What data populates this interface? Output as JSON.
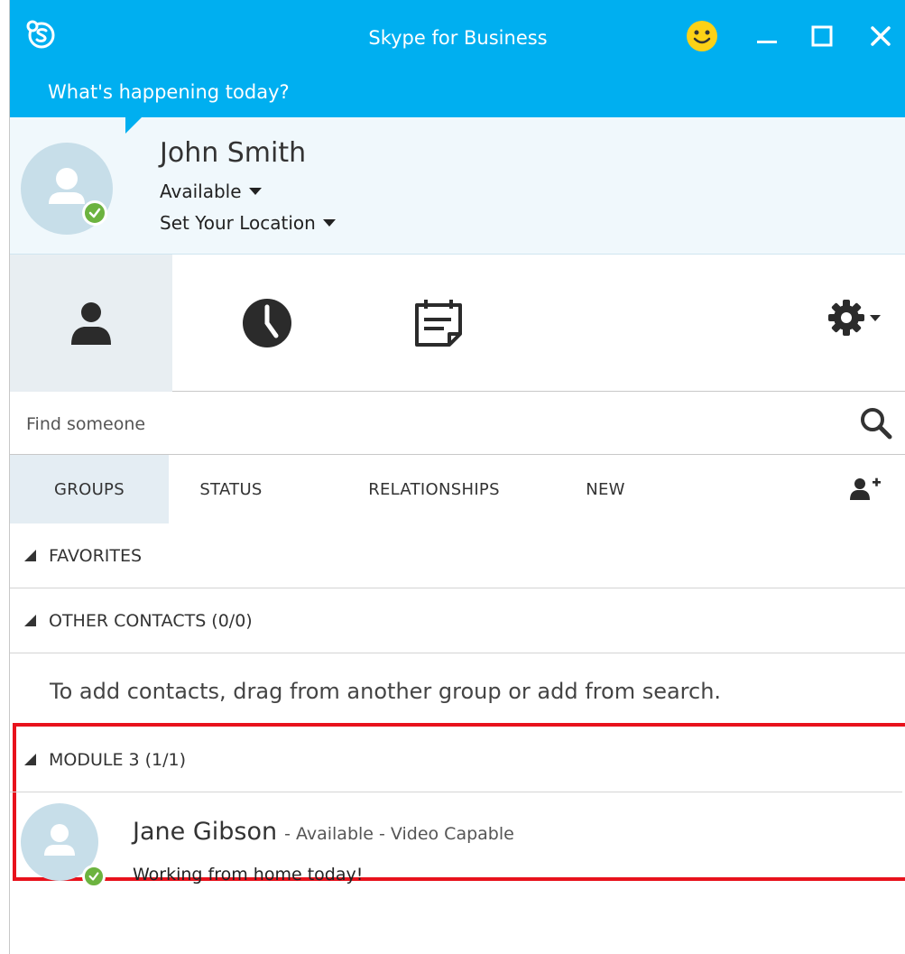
{
  "window": {
    "title": "Skype for Business"
  },
  "header": {
    "whats_happening": "What's happening today?"
  },
  "profile": {
    "name": "John Smith",
    "status": "Available",
    "location": "Set Your Location"
  },
  "search": {
    "placeholder": "Find someone"
  },
  "filters": [
    "GROUPS",
    "STATUS",
    "RELATIONSHIPS",
    "NEW"
  ],
  "groups": {
    "favorites": "FAVORITES",
    "other": "OTHER CONTACTS (0/0)",
    "empty_note": "To add contacts, drag from another group or add from search.",
    "module3": "MODULE 3 (1/1)"
  },
  "contact": {
    "name": "Jane Gibson",
    "meta": "- Available - Video Capable",
    "note": "Working from home today!"
  },
  "colors": {
    "titlebar": "#00aff0",
    "available": "#6cb33f",
    "highlight": "#e8121c"
  }
}
